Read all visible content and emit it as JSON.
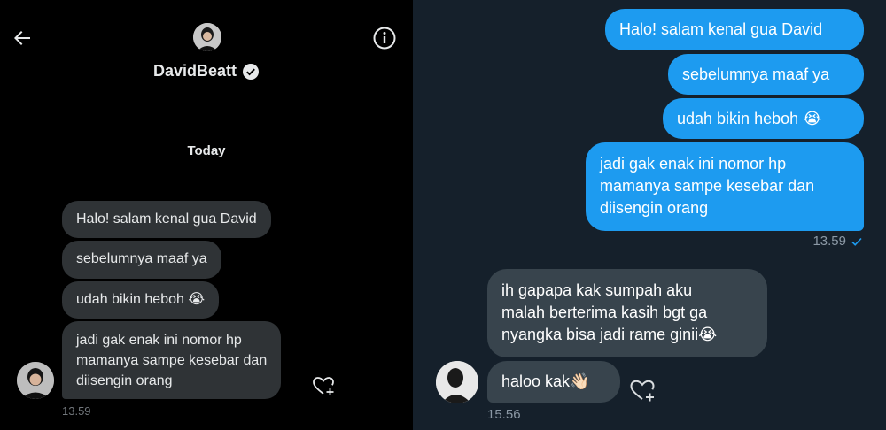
{
  "header": {
    "back_icon": "arrow-left-icon",
    "info_icon": "info-circle-icon",
    "username": "DavidBeatt",
    "verified_icon": "verified-badge-icon"
  },
  "conversation_left": {
    "day_label": "Today",
    "messages": [
      {
        "text": "Halo! salam kenal gua David"
      },
      {
        "text": "sebelumnya maaf ya"
      },
      {
        "text": "udah bikin heboh 😭"
      },
      {
        "text": "jadi gak enak ini nomor hp\nmamanya sampe kesebar dan\ndiisengin orang"
      }
    ],
    "time": "13.59",
    "react_icon": "heart-plus-icon"
  },
  "conversation_right": {
    "outgoing": [
      {
        "text": "Halo! salam kenal gua David"
      },
      {
        "text": "sebelumnya maaf ya"
      },
      {
        "text": "udah bikin heboh 😭"
      },
      {
        "text": "jadi gak enak ini nomor hp\nmamanya sampe kesebar dan\ndiisengin orang"
      }
    ],
    "outgoing_time": "13.59",
    "outgoing_status_icon": "check-icon",
    "incoming": [
      {
        "text": "ih gapapa kak sumpah aku\nmalah berterima kasih bgt ga\nnyangka bisa jadi rame ginii😭"
      },
      {
        "text": "haloo kak👋🏻"
      }
    ],
    "incoming_time": "15.56",
    "react_icon": "heart-plus-icon"
  },
  "colors": {
    "left_bg": "#000000",
    "right_bg": "#15202b",
    "left_bubble": "#2f3336",
    "outgoing_bubble": "#1d9bf0",
    "incoming_bubble": "#38444d"
  }
}
